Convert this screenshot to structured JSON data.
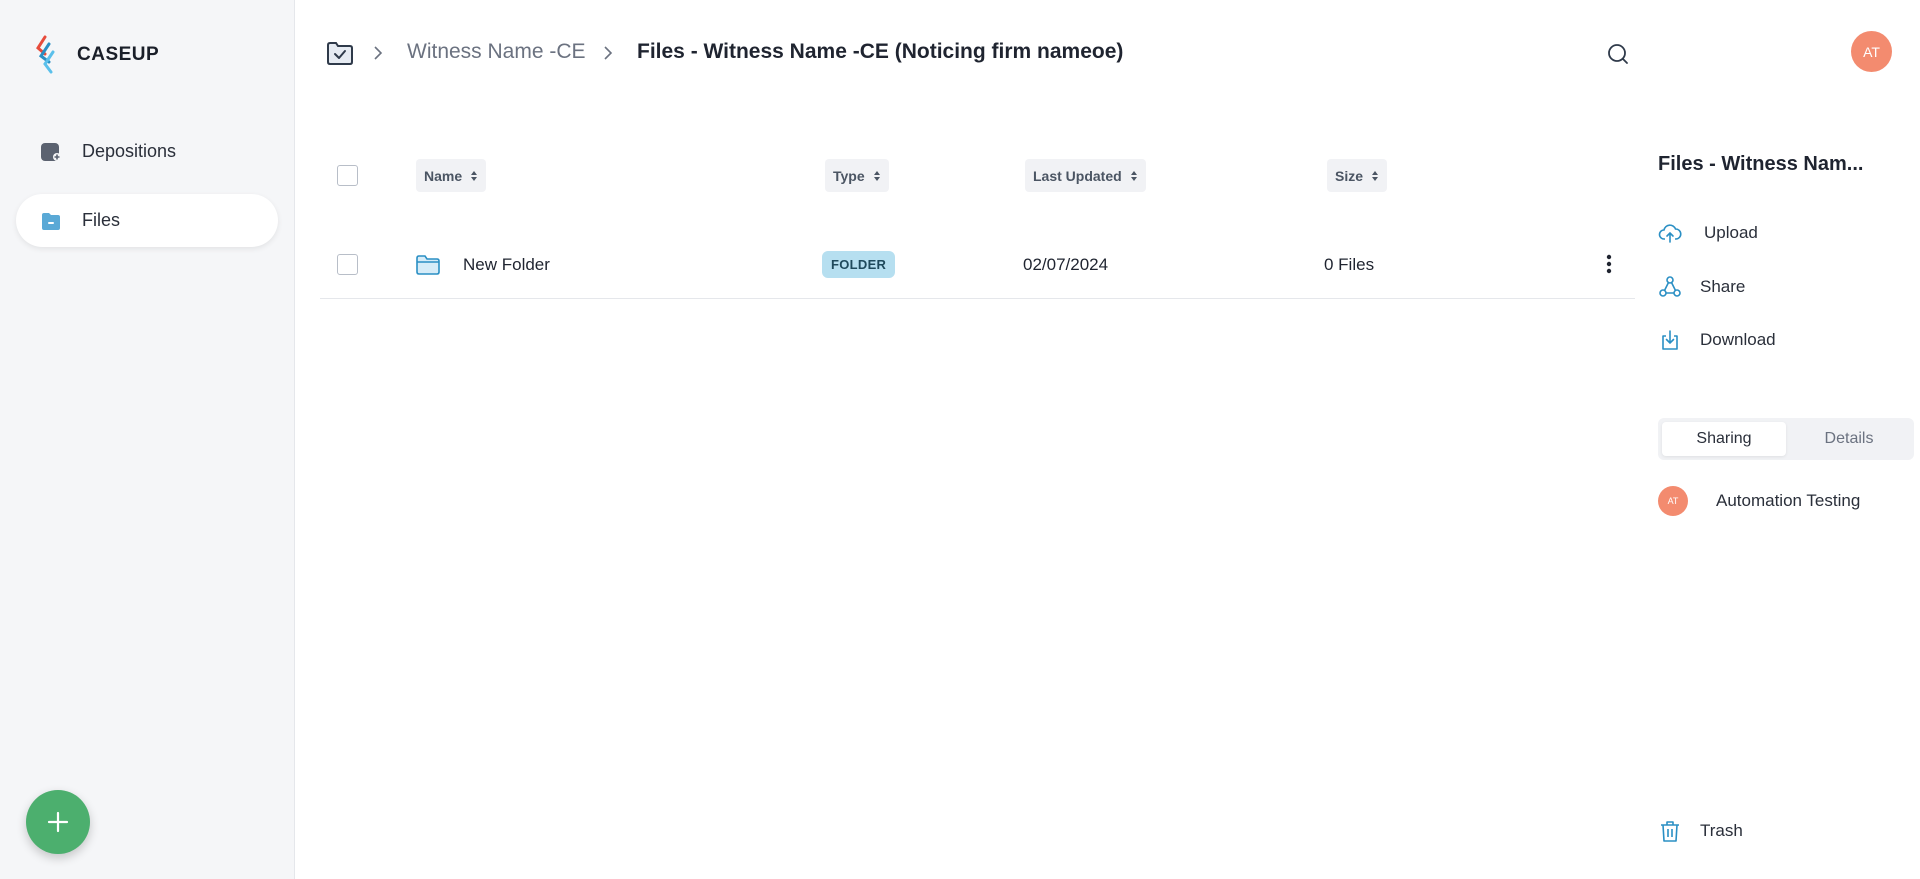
{
  "app": {
    "name": "CASEUP"
  },
  "sidebar": {
    "items": [
      {
        "label": "Depositions",
        "icon": "depositions-icon"
      },
      {
        "label": "Files",
        "icon": "files-icon",
        "active": true
      }
    ],
    "fab_icon": "plus-icon"
  },
  "breadcrumb": {
    "root_icon": "folder-check-icon",
    "items": [
      {
        "label": "Witness Name -CE"
      },
      {
        "label": "Files - Witness Name -CE (Noticing firm nameoe)"
      }
    ]
  },
  "header": {
    "search_icon": "search-icon",
    "user_initials": "AT"
  },
  "table": {
    "columns": [
      "Name",
      "Type",
      "Last Updated",
      "Size"
    ],
    "rows": [
      {
        "name": "New Folder",
        "type": "FOLDER",
        "last_updated": "02/07/2024",
        "size": "0 Files"
      }
    ]
  },
  "panel": {
    "title": "Files - Witness Nam...",
    "actions": [
      {
        "label": "Upload",
        "icon": "upload-cloud-icon"
      },
      {
        "label": "Share",
        "icon": "share-icon"
      },
      {
        "label": "Download",
        "icon": "download-icon"
      }
    ],
    "tabs": [
      {
        "label": "Sharing",
        "active": true
      },
      {
        "label": "Details",
        "active": false
      }
    ],
    "shared_with": [
      {
        "initials": "AT",
        "name": "Automation Testing"
      }
    ],
    "trash_label": "Trash"
  },
  "colors": {
    "accent": "#4caf6e",
    "avatar": "#f38b6f",
    "badge": "#b6dff0",
    "icon_blue": "#2a8fc4"
  }
}
